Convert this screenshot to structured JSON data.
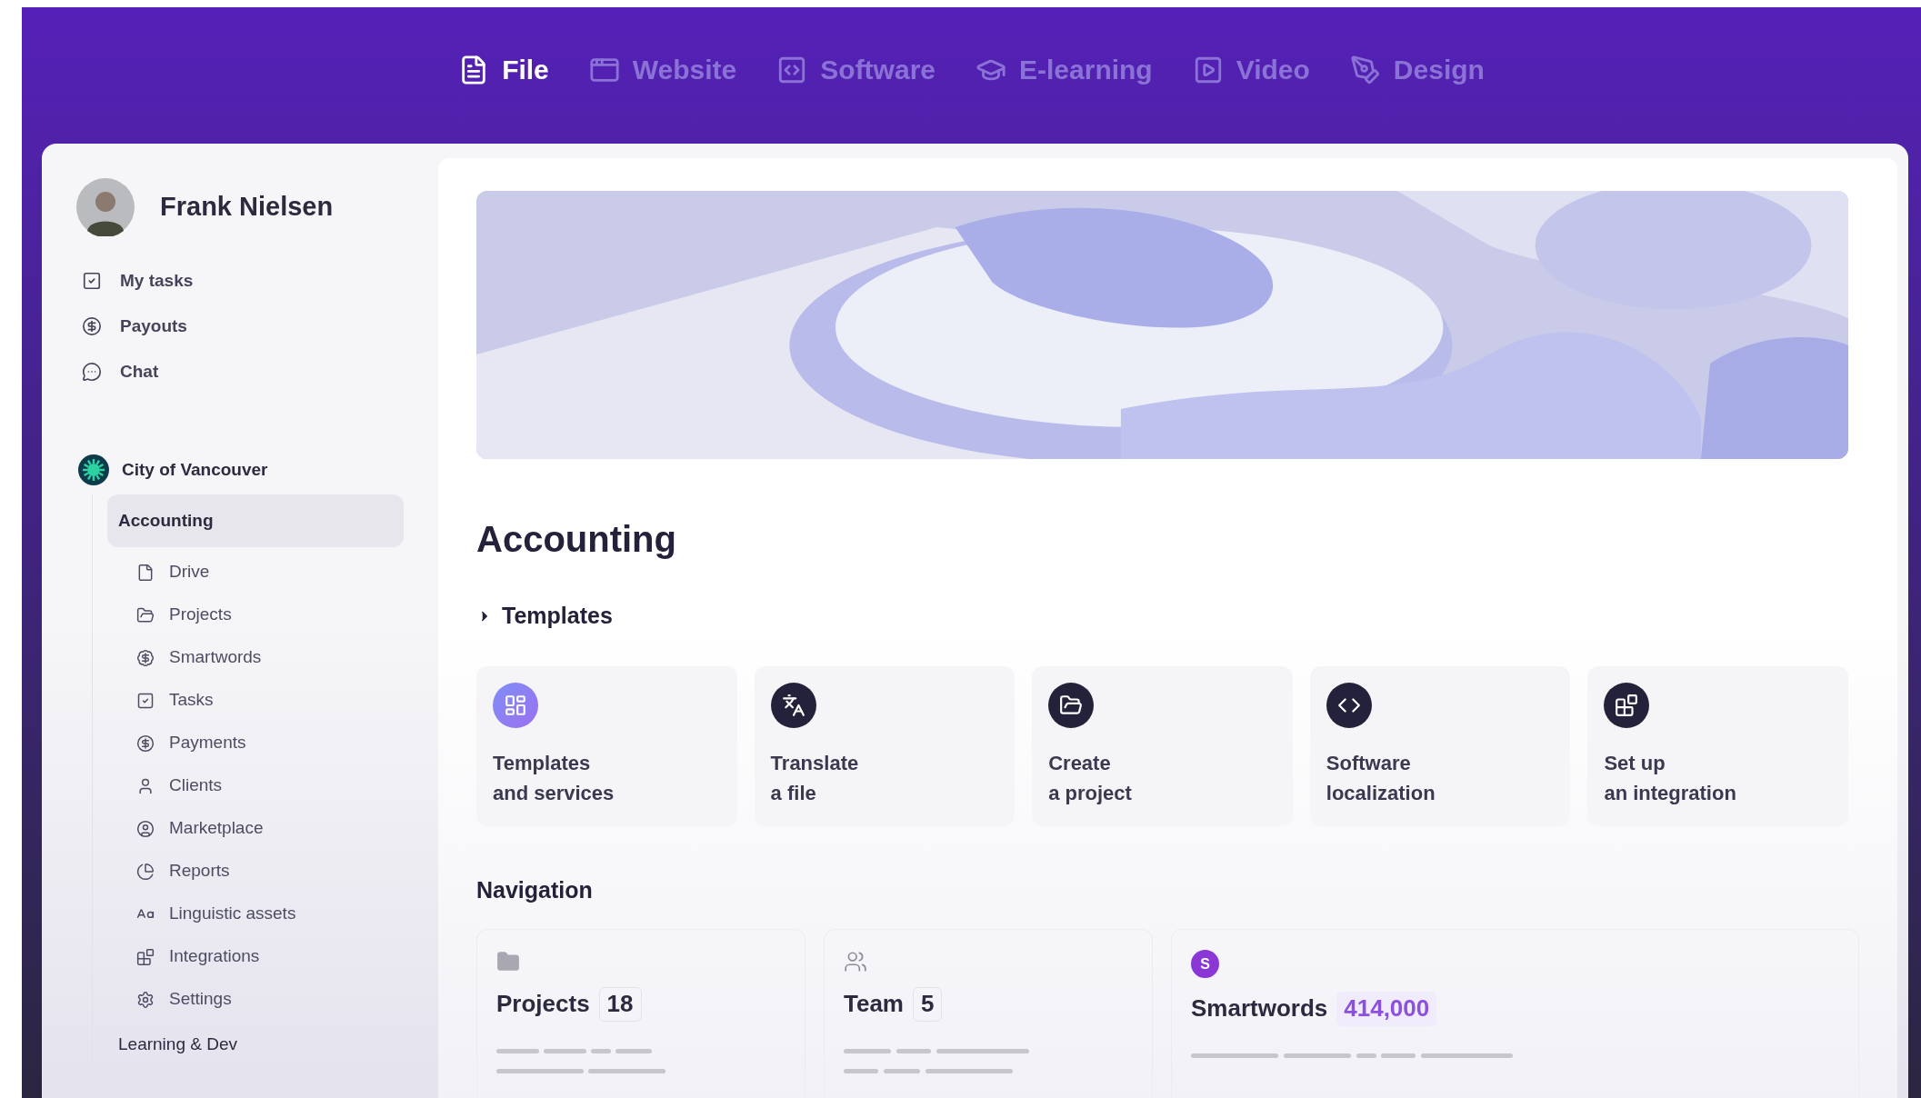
{
  "tabs": [
    {
      "kind": "file",
      "label": "File",
      "selected": true
    },
    {
      "kind": "website",
      "label": "Website",
      "selected": false
    },
    {
      "kind": "software",
      "label": "Software",
      "selected": false
    },
    {
      "kind": "elearning",
      "label": "E-learning",
      "selected": false
    },
    {
      "kind": "video",
      "label": "Video",
      "selected": false
    },
    {
      "kind": "design",
      "label": "Design",
      "selected": false
    }
  ],
  "user": {
    "name": "Frank Nielsen"
  },
  "sidebar": {
    "items": [
      {
        "kind": "tasks",
        "label": "My tasks"
      },
      {
        "kind": "payouts",
        "label": "Payouts"
      },
      {
        "kind": "chat",
        "label": "Chat"
      }
    ],
    "workspace": {
      "name": "City of Vancouver",
      "children": [
        {
          "label": "Accounting",
          "selected": true,
          "children": [
            {
              "kind": "drive",
              "label": "Drive"
            },
            {
              "kind": "projects",
              "label": "Projects"
            },
            {
              "kind": "smartwords",
              "label": "Smartwords"
            },
            {
              "kind": "tasks",
              "label": "Tasks"
            },
            {
              "kind": "payouts",
              "label": "Payments"
            },
            {
              "kind": "clients",
              "label": "Clients"
            },
            {
              "kind": "marketplace",
              "label": "Marketplace"
            },
            {
              "kind": "reports",
              "label": "Reports"
            },
            {
              "kind": "assets",
              "label": "Linguistic assets"
            },
            {
              "kind": "integrations",
              "label": "Integrations"
            },
            {
              "kind": "settings",
              "label": "Settings"
            }
          ]
        },
        {
          "label": "Learning & Dev",
          "selected": false
        }
      ]
    }
  },
  "main": {
    "title": "Accounting",
    "templates": {
      "label": "Templates",
      "expanded": false,
      "cards": [
        {
          "kind": "templates",
          "lines": [
            "Templates",
            "and services"
          ]
        },
        {
          "kind": "translate",
          "lines": [
            "Translate",
            "a file"
          ]
        },
        {
          "kind": "project",
          "lines": [
            "Create",
            "a project"
          ]
        },
        {
          "kind": "software",
          "lines": [
            "Software",
            "localization"
          ]
        },
        {
          "kind": "integration",
          "lines": [
            "Set up",
            "an integration"
          ]
        }
      ]
    },
    "navigation": {
      "label": "Navigation",
      "cards": [
        {
          "kind": "projects",
          "label": "Projects",
          "count": "18"
        },
        {
          "kind": "team",
          "label": "Team",
          "count": "5"
        },
        {
          "kind": "smartwords",
          "label": "Smartwords",
          "count": "414,000",
          "icon_text": "S"
        }
      ]
    }
  }
}
